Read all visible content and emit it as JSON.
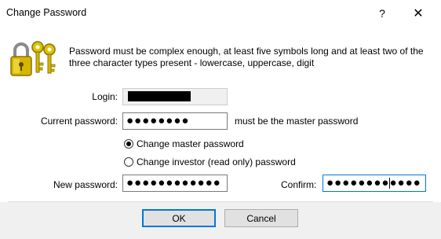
{
  "window": {
    "title": "Change Password",
    "help_glyph": "?",
    "close_glyph": "✕"
  },
  "info_text": "Password must be complex enough, at least five symbols long and at least two of the three character types present - lowercase, uppercase, digit",
  "icon": "keys-lock-icon",
  "form": {
    "login_label": "Login:",
    "login_value_masked": true,
    "current_password_label": "Current password:",
    "current_password_value": "●●●●●●●●",
    "current_password_hint": "must be the master password",
    "radio_master_label": "Change master password",
    "radio_master_selected": true,
    "radio_investor_label": "Change investor (read only) password",
    "radio_investor_selected": false,
    "new_password_label": "New password:",
    "new_password_value": "●●●●●●●●●●●●",
    "confirm_label": "Confirm:",
    "confirm_value": "●●●●●●●●●●●●"
  },
  "buttons": {
    "ok_label": "OK",
    "cancel_label": "Cancel"
  },
  "colors": {
    "focus_border": "#0078d7",
    "footer_bg": "#f0f0f0"
  }
}
